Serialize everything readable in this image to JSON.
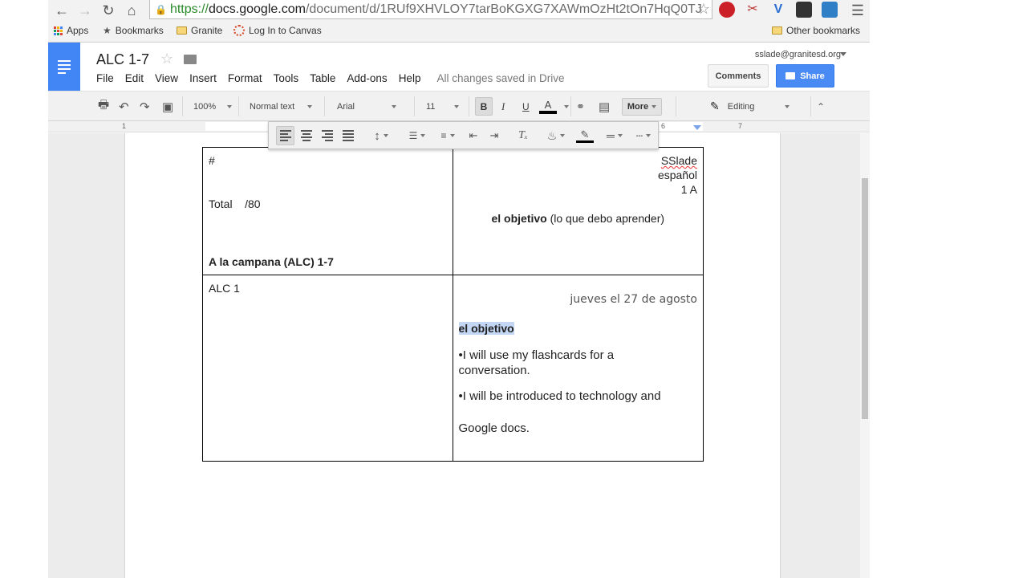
{
  "browser": {
    "url_scheme": "https://",
    "url_host": "docs.google.com",
    "url_path": "/document/d/1RUf9XHVLOY7tarBoKGXG7XAWmOzHt2tOn7HqQ0TJ",
    "bookmarks": {
      "apps": "Apps",
      "bookmarks": "Bookmarks",
      "granite": "Granite",
      "canvas": "Log In to Canvas",
      "other": "Other bookmarks"
    }
  },
  "docs": {
    "title": "ALC 1-7",
    "menu": [
      "File",
      "Edit",
      "View",
      "Insert",
      "Format",
      "Tools",
      "Table",
      "Add-ons",
      "Help"
    ],
    "save_status": "All changes saved in Drive",
    "account": "sslade@granitesd.org",
    "comments_label": "Comments",
    "share_label": "Share"
  },
  "toolbar": {
    "zoom": "100%",
    "style": "Normal text",
    "font": "Arial",
    "size": "11",
    "bold": "B",
    "italic": "I",
    "underline": "U",
    "text_color": "A",
    "more": "More",
    "mode": "Editing"
  },
  "ruler": {
    "left_num": "1",
    "right_num_6": "6",
    "right_num_7": "7"
  },
  "table": {
    "r1c1": {
      "hash": "#",
      "total": "Total    /80",
      "heading": "A la campana (ALC) 1-7"
    },
    "r1c2": {
      "name": "SSlade",
      "subject": "español",
      "period": "1 A",
      "objective_bold": "el objetivo",
      "objective_rest": " (lo que debo aprender)"
    },
    "r2c1": {
      "label": "ALC 1"
    },
    "r2c2": {
      "date": "jueves el 27 de agosto",
      "objective_heading": "el objetivo",
      "bullet1": "•I will use my flashcards for a conversation.",
      "bullet2": "•I will be introduced to technology and",
      "bullet2_cont": "Google docs."
    }
  },
  "colors": {
    "docs_blue": "#4285f4",
    "share_blue": "#4a8af4",
    "highlight": "#c3d6f3"
  }
}
